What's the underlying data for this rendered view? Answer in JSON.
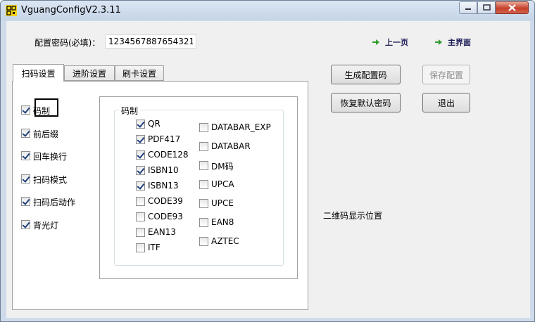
{
  "window": {
    "title": "VguangConfigV2.3.11"
  },
  "header": {
    "password_label": "配置密码(必填)：",
    "password_value": "1234567887654321",
    "prev_page": "上一页",
    "main_page": "主界面"
  },
  "buttons": {
    "generate": "生成配置码",
    "save": "保存配置",
    "restore": "恢复默认密码",
    "exit": "退出"
  },
  "tabs": [
    {
      "label": "扫码设置"
    },
    {
      "label": "进阶设置"
    },
    {
      "label": "刷卡设置"
    }
  ],
  "left_options": [
    {
      "label": "码制",
      "checked": true
    },
    {
      "label": "前后缀",
      "checked": true
    },
    {
      "label": "回车换行",
      "checked": true
    },
    {
      "label": "扫码模式",
      "checked": true
    },
    {
      "label": "扫码后动作",
      "checked": true
    },
    {
      "label": "背光灯",
      "checked": true
    }
  ],
  "codes_group": {
    "legend": "码制",
    "col1": [
      {
        "label": "QR",
        "checked": true
      },
      {
        "label": "PDF417",
        "checked": true
      },
      {
        "label": "CODE128",
        "checked": true
      },
      {
        "label": "ISBN10",
        "checked": true
      },
      {
        "label": "ISBN13",
        "checked": true
      },
      {
        "label": "CODE39",
        "checked": false
      },
      {
        "label": "CODE93",
        "checked": false
      },
      {
        "label": "EAN13",
        "checked": false
      },
      {
        "label": "ITF",
        "checked": false
      }
    ],
    "col2": [
      {
        "label": "DATABAR_EXP",
        "checked": false
      },
      {
        "label": "DATABAR",
        "checked": false
      },
      {
        "label": "DM码",
        "checked": false
      },
      {
        "label": "UPCA",
        "checked": false
      },
      {
        "label": "UPCE",
        "checked": false
      },
      {
        "label": "EAN8",
        "checked": false
      },
      {
        "label": "AZTEC",
        "checked": false
      }
    ]
  },
  "qr_placeholder": "二维码显示位置",
  "colors": {
    "nav_arrow": "#2f9a2f",
    "checkmark": "#1e3f7a",
    "close_button": "#c6402a"
  }
}
